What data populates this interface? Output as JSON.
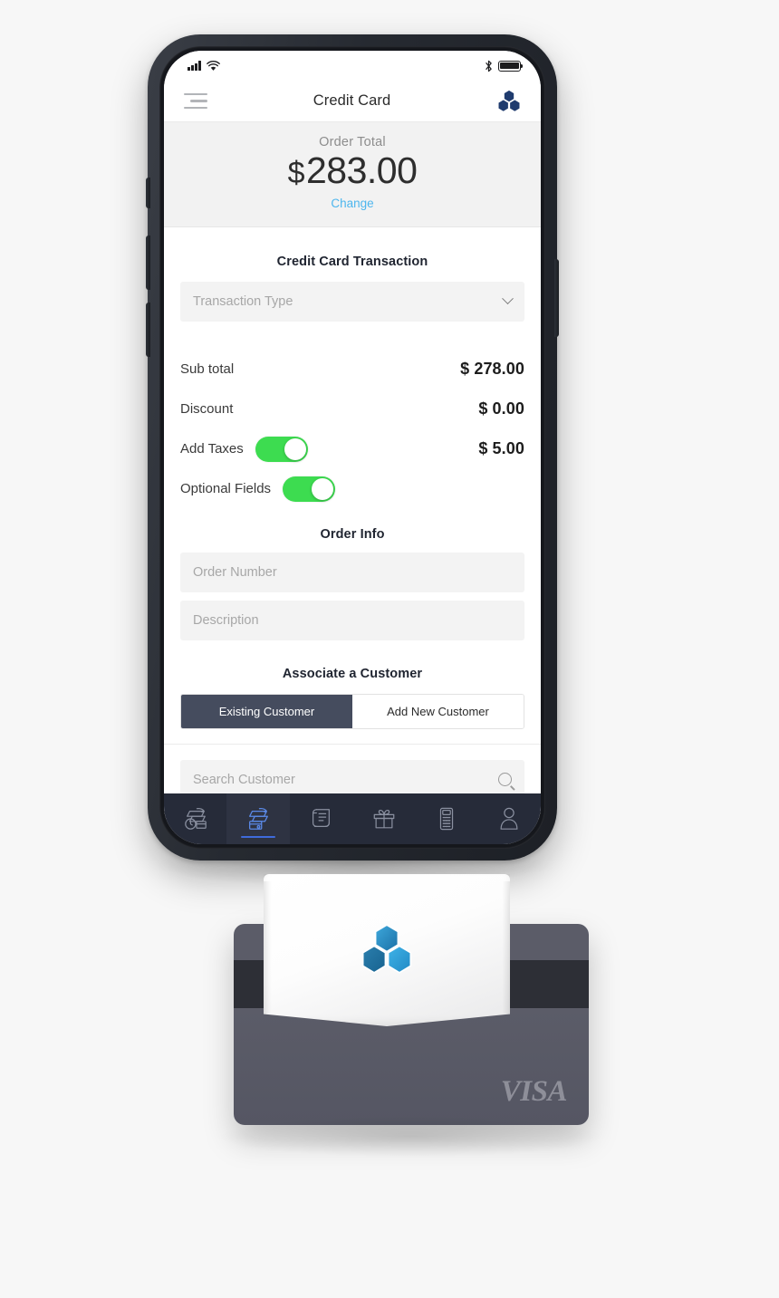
{
  "status_bar": {
    "signal_icon": "cellular-signal-icon",
    "wifi_icon": "wifi-icon",
    "bluetooth_icon": "bluetooth-icon",
    "battery_icon": "battery-full-icon"
  },
  "header": {
    "menu_icon": "hamburger-menu-icon",
    "title": "Credit Card",
    "logo_icon": "hex-cube-logo-icon"
  },
  "order_total": {
    "label": "Order Total",
    "currency": "$",
    "amount": "283.00",
    "change_link": "Change"
  },
  "transaction": {
    "section_title": "Credit Card Transaction",
    "type_placeholder": "Transaction Type",
    "type_value": "",
    "dropdown_icon": "chevron-down-icon",
    "rows": [
      {
        "label": "Sub total",
        "value": "$ 278.00",
        "toggle": null
      },
      {
        "label": "Discount",
        "value": "$ 0.00",
        "toggle": null
      },
      {
        "label": "Add Taxes",
        "value": "$ 5.00",
        "toggle": "on"
      },
      {
        "label": "Optional Fields",
        "value": "",
        "toggle": "on"
      }
    ]
  },
  "order_info": {
    "section_title": "Order Info",
    "order_number_placeholder": "Order Number",
    "order_number_value": "",
    "description_placeholder": "Description",
    "description_value": ""
  },
  "customer": {
    "section_title": "Associate a Customer",
    "tabs": [
      {
        "label": "Existing Customer",
        "selected": true
      },
      {
        "label": "Add New Customer",
        "selected": false
      }
    ],
    "search_placeholder": "Search Customer",
    "search_value": "",
    "search_icon": "magnifier-icon"
  },
  "tab_bar": {
    "items": [
      {
        "name": "tab-transaction-history",
        "icon": "clock-transaction-icon",
        "active": false
      },
      {
        "name": "tab-new-transaction",
        "icon": "card-transaction-icon",
        "active": true
      },
      {
        "name": "tab-receipts",
        "icon": "receipt-scroll-icon",
        "active": false
      },
      {
        "name": "tab-gift-cards",
        "icon": "gift-box-icon",
        "active": false
      },
      {
        "name": "tab-card-reader",
        "icon": "card-terminal-icon",
        "active": false
      },
      {
        "name": "tab-customers",
        "icon": "person-icon",
        "active": false
      }
    ]
  },
  "hardware": {
    "reader_logo_icon": "hex-cube-logo-icon",
    "card_brand": "VISA"
  },
  "colors": {
    "accent_link": "#4db6ee",
    "toggle_on": "#3ddc50",
    "segment_selected": "#454c5e",
    "tab_bar_bg": "#262b39",
    "tab_active_underline": "#3f6bdb",
    "panel_bg": "#f2f2f2",
    "field_bg": "#f3f3f3",
    "logo_navy": "#1f3b6e",
    "card_gray": "#5b5c68"
  }
}
